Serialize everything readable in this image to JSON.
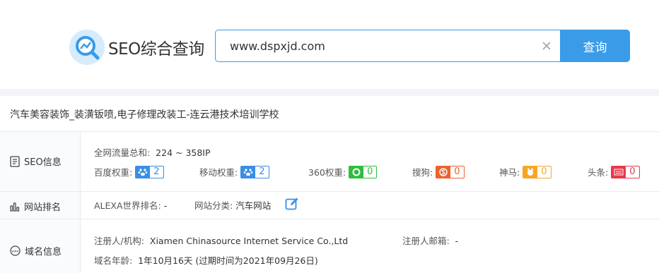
{
  "header": {
    "logo_text": "SEO综合查询",
    "search_value": "www.dspxjd.com",
    "query_label": "查询"
  },
  "site_title": "汽车美容装饰_装潢钣喷,电子修理改装工-连云港技术培训学校",
  "seo_info": {
    "label": "SEO信息",
    "traffic_label": "全网流量总和:",
    "traffic_value": "224 ~ 358IP",
    "metrics": [
      {
        "label": "百度权重:",
        "value": "2",
        "color": "#3a8ee6",
        "icon": "baidu-paw-icon"
      },
      {
        "label": "移动权重:",
        "value": "2",
        "color": "#3a8ee6",
        "icon": "mobile-paw-icon"
      },
      {
        "label": "360权重:",
        "value": "0",
        "color": "#2ebd3f",
        "icon": "360-icon"
      },
      {
        "label": "搜狗:",
        "value": "0",
        "color": "#f0602a",
        "icon": "sogou-icon"
      },
      {
        "label": "神马:",
        "value": "0",
        "color": "#f5a623",
        "icon": "shenma-icon"
      },
      {
        "label": "头条:",
        "value": "0",
        "color": "#e8394b",
        "icon": "toutiao-icon"
      }
    ]
  },
  "site_rank": {
    "label": "网站排名",
    "alexa_label": "ALEXA世界排名:",
    "alexa_value": "-",
    "category_label": "网站分类:",
    "category_value": "汽车网站"
  },
  "domain_info": {
    "label": "域名信息",
    "registrant_label": "注册人/机构:",
    "registrant_value": "Xiamen Chinasource Internet Service Co.,Ltd",
    "email_label": "注册人邮箱:",
    "email_value": "-",
    "age_label": "域名年龄:",
    "age_value": "1年10月16天",
    "expire_text": "(过期时间为2021年09月26日)"
  }
}
